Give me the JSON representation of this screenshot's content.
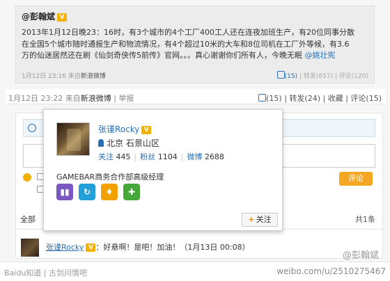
{
  "original_post": {
    "author": "@彭翰斌",
    "verified_badge": "V",
    "text_lines": [
      "2013年1月12日晚23：16时，有3个城市的4个工厂400工人还在连夜加班生产，有20位同事分散",
      "在全国5个城市随时通报生产和物流情况，有4个超过10米的大车和8位司机在工厂外等候，有3.6",
      "万的仙迷居然还在刷《仙剑奇侠传5前传》官网。。。真心谢谢你们所有人，今晚无眠 "
    ],
    "mention": "@姚壮宪",
    "time": "1月12日 23:16",
    "source_prefix": "来自",
    "source": "新浪微博",
    "like": "(15)",
    "repost": "转发(857)",
    "comment": "评论(120)"
  },
  "post_meta": {
    "time": "1月12日 23:22",
    "source_prefix": "来自",
    "source": "新浪微博",
    "report": "举报",
    "like": "(15)",
    "repost": "转发(24)",
    "favorite": "收藏",
    "comment": "评论(15)"
  },
  "comment_box": {
    "submit": "评论",
    "filter_all": "全部",
    "total": "共1条"
  },
  "user_card": {
    "name": "张谨Rocky",
    "verified_badge": "V",
    "location": "北京 石景山区",
    "follow_label": "关注",
    "follow_count": "445",
    "fans_label": "粉丝",
    "fans_count": "1104",
    "weibo_label": "微博",
    "weibo_count": "2688",
    "description": "GAMEBAR商务合作部高级经理",
    "follow_button": "关注",
    "follow_plus": "+"
  },
  "comment": {
    "author": "张谨Rocky",
    "badge": "V",
    "text": "：好悬啊！是吧！加油！（1月13日 00:08）"
  },
  "footer": {
    "left_text": "Baidu知道 | 古剑问情吧",
    "watermark": "weibo.com/u/2510275467",
    "overlay": "@彭翰斌"
  },
  "colors": {
    "link": "#2a6fb3",
    "verified": "#f2b000",
    "submit": "#f5a623"
  }
}
